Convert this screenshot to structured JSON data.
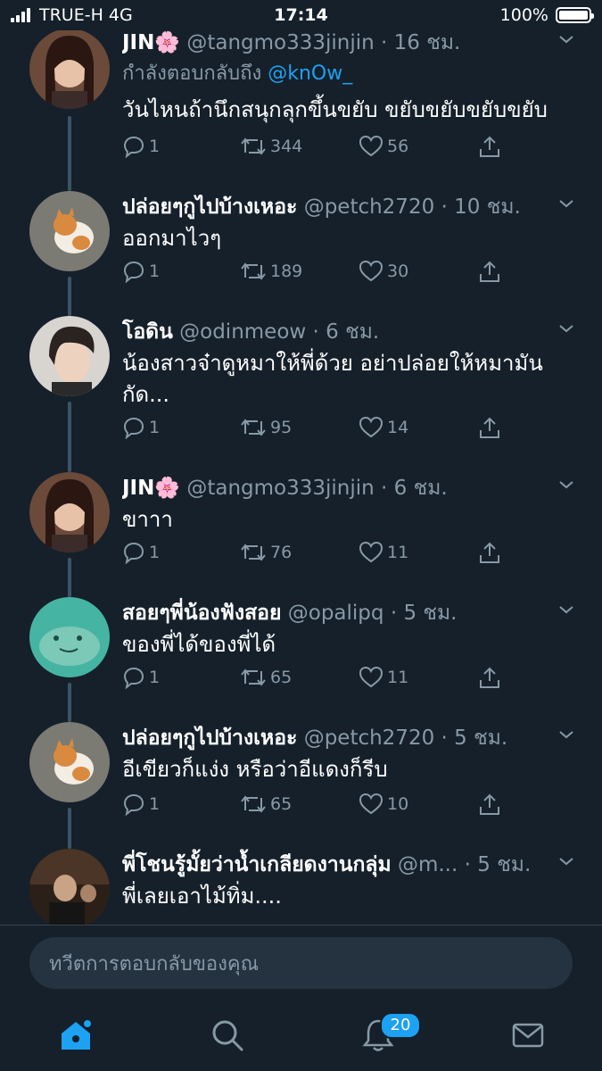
{
  "status_bar": {
    "carrier": "TRUE-H",
    "network": "4G",
    "time": "17:14",
    "battery": "100%"
  },
  "tweets": [
    {
      "name": "JIN🌸",
      "handle": "@tangmo333jinjin",
      "time": "· 16 ชม.",
      "reply_prefix": "กำลังตอบกลับถึง",
      "reply_to": "@knOw_",
      "text": "วันไหนถ้านึกสนุกลุกขึ้นขยับ ขยับขยับขยับขยับ",
      "replies": "1",
      "retweets": "344",
      "likes": "56"
    },
    {
      "name": "ปล่อยๆกูไปบ้างเหอะ",
      "handle": "@petch2720",
      "time": "· 10 ชม.",
      "text": "ออกมาไวๆ",
      "replies": "1",
      "retweets": "189",
      "likes": "30"
    },
    {
      "name": "โอดิน",
      "handle": "@odinmeow",
      "time": "· 6 ชม.",
      "text": "น้องสาวจ๋าดูหมาให้พี่ด้วย อย่าปล่อยให้หมามันกัด...",
      "replies": "1",
      "retweets": "95",
      "likes": "14"
    },
    {
      "name": "JIN🌸",
      "handle": "@tangmo333jinjin",
      "time": "· 6 ชม.",
      "text": "ขาาา",
      "replies": "1",
      "retweets": "76",
      "likes": "11"
    },
    {
      "name": "สอยๆพี่น้องฟังสอย",
      "handle": "@opalipq",
      "time": "· 5 ชม.",
      "text": "ของพี่ได้ของพี่ได้",
      "replies": "1",
      "retweets": "65",
      "likes": "11"
    },
    {
      "name": "ปล่อยๆกูไปบ้างเหอะ",
      "handle": "@petch2720",
      "time": "· 5 ชม.",
      "text": "อีเขียวก็แง่ง หรือว่าอีแดงก็รีบ",
      "replies": "1",
      "retweets": "65",
      "likes": "10"
    },
    {
      "name": "พี่โชนรู้มั้ยว่าน้ำเกลียดงานกลุ่ม",
      "handle": "@m...",
      "time": "· 5 ชม.",
      "text": "พี่เลยเอาไม้ทิ่ม...."
    }
  ],
  "reply_box": {
    "placeholder": "ทวีตการตอบกลับของคุณ"
  },
  "tab_bar": {
    "items": [
      "home-icon",
      "search-icon",
      "bell-icon",
      "mail-icon"
    ],
    "notifications_badge": "20"
  },
  "colors": {
    "background": "#15202b",
    "accent": "#1da1f2",
    "muted": "#8899a6",
    "thread_line": "#3d5466"
  }
}
